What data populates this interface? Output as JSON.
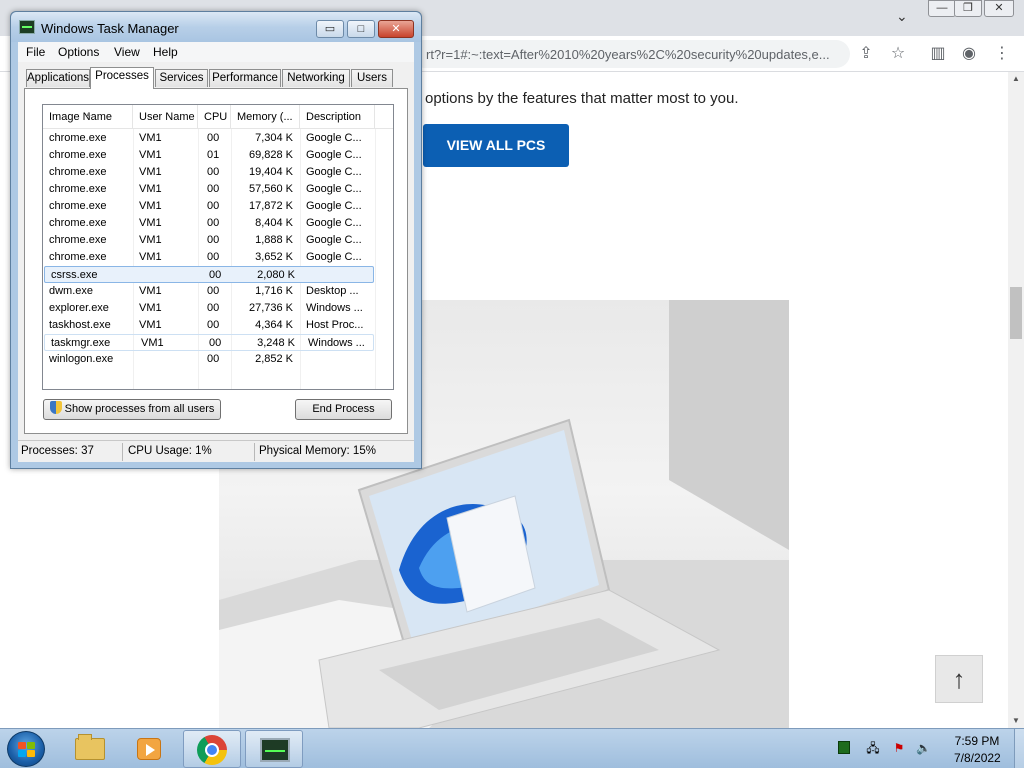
{
  "browser": {
    "url_text": "rt?r=1#:~:text=After%2010%20years%2C%20security%20updates,e...",
    "window_controls": {
      "minimize": "—",
      "restore": "❐",
      "close": "✕"
    },
    "page": {
      "intro_text": "options by the features that matter most to you.",
      "view_all_label": "VIEW ALL PCS",
      "back_to_top_label": "↑"
    }
  },
  "taskmgr": {
    "title": "Windows Task Manager",
    "caption_buttons": {
      "minimize": "▭",
      "maximize": "□",
      "close": "✕"
    },
    "menu": [
      "File",
      "Options",
      "View",
      "Help"
    ],
    "tabs": [
      "Applications",
      "Processes",
      "Services",
      "Performance",
      "Networking",
      "Users"
    ],
    "active_tab": "Processes",
    "columns": [
      "Image Name",
      "User Name",
      "CPU",
      "Memory (...",
      "Description"
    ],
    "processes": [
      {
        "name": "chrome.exe",
        "user": "VM1",
        "cpu": "00",
        "mem": "7,304 K",
        "desc": "Google C..."
      },
      {
        "name": "chrome.exe",
        "user": "VM1",
        "cpu": "01",
        "mem": "69,828 K",
        "desc": "Google C..."
      },
      {
        "name": "chrome.exe",
        "user": "VM1",
        "cpu": "00",
        "mem": "19,404 K",
        "desc": "Google C..."
      },
      {
        "name": "chrome.exe",
        "user": "VM1",
        "cpu": "00",
        "mem": "57,560 K",
        "desc": "Google C..."
      },
      {
        "name": "chrome.exe",
        "user": "VM1",
        "cpu": "00",
        "mem": "17,872 K",
        "desc": "Google C..."
      },
      {
        "name": "chrome.exe",
        "user": "VM1",
        "cpu": "00",
        "mem": "8,404 K",
        "desc": "Google C..."
      },
      {
        "name": "chrome.exe",
        "user": "VM1",
        "cpu": "00",
        "mem": "1,888 K",
        "desc": "Google C..."
      },
      {
        "name": "chrome.exe",
        "user": "VM1",
        "cpu": "00",
        "mem": "3,652 K",
        "desc": "Google C..."
      },
      {
        "name": "csrss.exe",
        "user": "",
        "cpu": "00",
        "mem": "2,080 K",
        "desc": ""
      },
      {
        "name": "dwm.exe",
        "user": "VM1",
        "cpu": "00",
        "mem": "1,716 K",
        "desc": "Desktop ..."
      },
      {
        "name": "explorer.exe",
        "user": "VM1",
        "cpu": "00",
        "mem": "27,736 K",
        "desc": "Windows ..."
      },
      {
        "name": "taskhost.exe",
        "user": "VM1",
        "cpu": "00",
        "mem": "4,364 K",
        "desc": "Host Proc..."
      },
      {
        "name": "taskmgr.exe",
        "user": "VM1",
        "cpu": "00",
        "mem": "3,248 K",
        "desc": "Windows ..."
      },
      {
        "name": "winlogon.exe",
        "user": "",
        "cpu": "00",
        "mem": "2,852 K",
        "desc": ""
      }
    ],
    "selected_row": 8,
    "hovered_row": 12,
    "show_all_label": "Show processes from all users",
    "end_process_label": "End Process",
    "status": {
      "processes": "Processes: 37",
      "cpu": "CPU Usage: 1%",
      "memory": "Physical Memory: 15%"
    }
  },
  "taskbar": {
    "apps": [
      "start-button",
      "windows-explorer",
      "windows-media-player",
      "google-chrome",
      "task-manager"
    ],
    "clock": {
      "time": "7:59 PM",
      "date": "7/8/2022"
    }
  },
  "colors": {
    "view_all_button": "#0c5fb3",
    "taskbar": "#9fbedd",
    "selection": "#e8f1fb"
  }
}
